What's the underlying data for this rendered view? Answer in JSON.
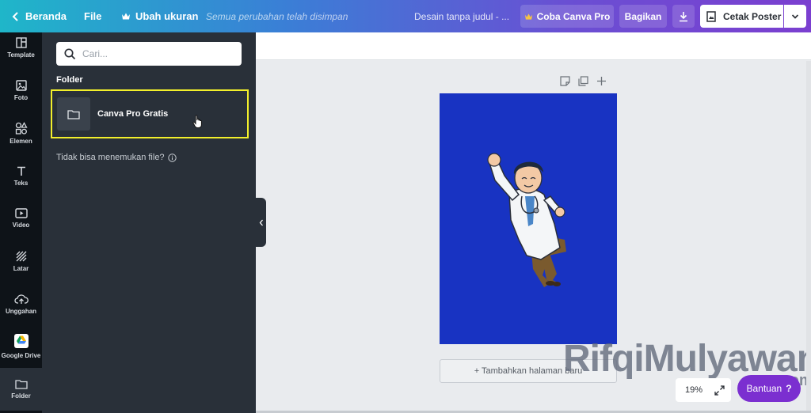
{
  "topbar": {
    "back_label": "Beranda",
    "file_label": "File",
    "resize_label": "Ubah ukuran",
    "saved_status": "Semua perubahan telah disimpan",
    "doc_title": "Desain tanpa judul - ...",
    "try_pro_label": "Coba Canva Pro",
    "share_label": "Bagikan",
    "print_label": "Cetak Poster",
    "colors": {
      "gradient_start": "#1fb6c9",
      "gradient_end": "#7b3fd0"
    }
  },
  "rail": {
    "items": [
      {
        "label": "Template",
        "icon": "template-icon"
      },
      {
        "label": "Foto",
        "icon": "photo-icon"
      },
      {
        "label": "Elemen",
        "icon": "elements-icon"
      },
      {
        "label": "Teks",
        "icon": "text-icon"
      },
      {
        "label": "Video",
        "icon": "video-icon"
      },
      {
        "label": "Latar",
        "icon": "background-icon"
      },
      {
        "label": "Unggahan",
        "icon": "upload-icon"
      },
      {
        "label": "Google Drive",
        "icon": "google-drive-icon"
      },
      {
        "label": "Folder",
        "icon": "folder-icon"
      }
    ]
  },
  "panel": {
    "search_placeholder": "Cari...",
    "folder_heading": "Folder",
    "folder_item": "Canva Pro Gratis",
    "not_found_text": "Tidak bisa menemukan file?"
  },
  "canvas": {
    "page_color": "#1833c2",
    "add_page_label": "+ Tambahkan halaman baru",
    "zoom_level": "19%",
    "help_label": "Bantuan",
    "help_symbol": "?"
  },
  "watermark": {
    "text": "RifqiMulyawan",
    "suffix": ".com"
  }
}
